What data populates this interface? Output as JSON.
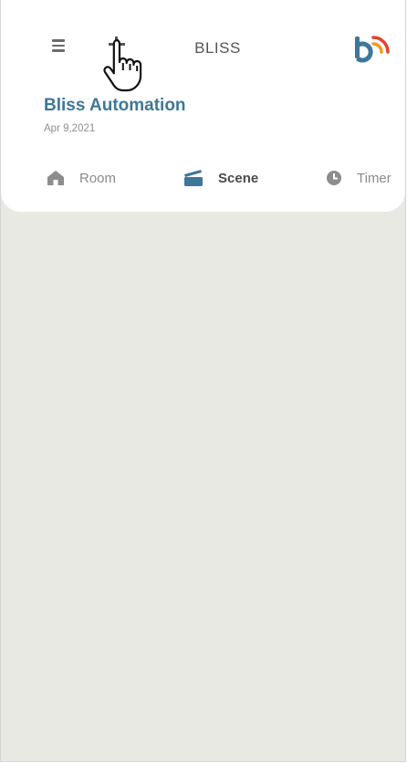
{
  "header": {
    "title": "BLISS",
    "menu_icon": "hamburger-menu-icon",
    "add_icon": "plus-icon",
    "logo": "bliss-logo"
  },
  "home": {
    "name": "Bliss Automation",
    "date": "Apr 9,2021"
  },
  "tabs": [
    {
      "label": "Room",
      "icon": "home-icon",
      "active": false
    },
    {
      "label": "Scene",
      "icon": "scene-icon",
      "active": true
    },
    {
      "label": "Timer",
      "icon": "clock-icon",
      "active": false
    }
  ],
  "colors": {
    "accent": "#3d7899",
    "background": "#e9e9e4",
    "logo_blue": "#3d7899",
    "logo_orange": "#f39a1e",
    "logo_red": "#e4422c"
  }
}
